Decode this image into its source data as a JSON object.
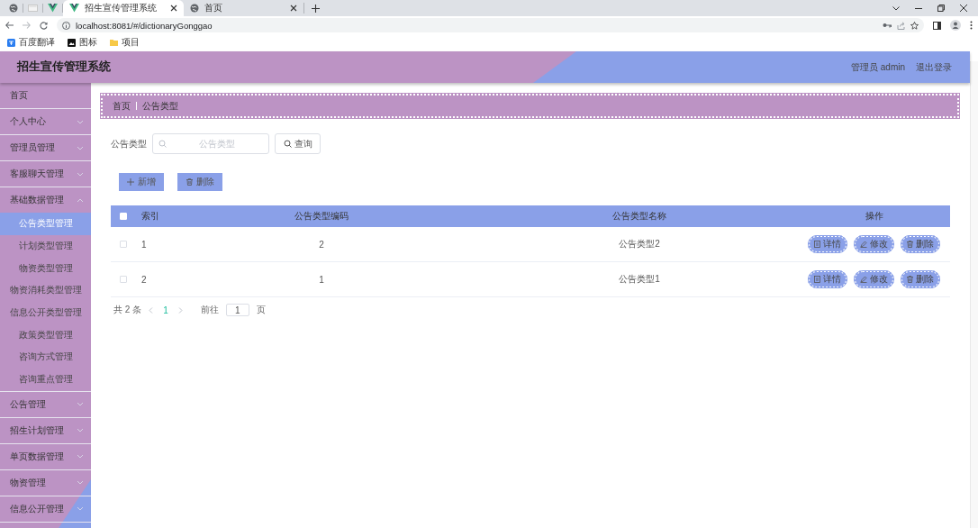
{
  "browser": {
    "tabs": [
      {
        "kind": "globe",
        "selected": false
      },
      {
        "kind": "blank",
        "selected": false
      },
      {
        "kind": "vue",
        "selected": false
      },
      {
        "kind": "vue",
        "label": "招生宣传管理系统",
        "selected": true
      },
      {
        "kind": "globe",
        "label": "首页",
        "selected": false
      }
    ],
    "address": "localhost:8081/#/dictionaryGonggao",
    "bookmarks": [
      {
        "kind": "translate",
        "label": "百度翻译"
      },
      {
        "kind": "image",
        "label": "图标"
      },
      {
        "kind": "folder",
        "label": "项目"
      }
    ]
  },
  "app": {
    "title": "招生宣传管理系统",
    "user": "管理员 admin",
    "logout": "退出登录"
  },
  "sidebar": {
    "items": [
      {
        "label": "首页",
        "kind": "link"
      },
      {
        "label": "个人中心",
        "kind": "menu",
        "expanded": false
      },
      {
        "label": "管理员管理",
        "kind": "menu",
        "expanded": false
      },
      {
        "label": "客服聊天管理",
        "kind": "menu",
        "expanded": false
      },
      {
        "label": "基础数据管理",
        "kind": "menu",
        "expanded": true,
        "children": [
          {
            "label": "公告类型管理",
            "selected": true
          },
          {
            "label": "计划类型管理",
            "selected": false
          },
          {
            "label": "物资类型管理",
            "selected": false
          },
          {
            "label": "物资消耗类型管理",
            "selected": false
          },
          {
            "label": "信息公开类型管理",
            "selected": false
          },
          {
            "label": "政策类型管理",
            "selected": false
          },
          {
            "label": "咨询方式管理",
            "selected": false
          },
          {
            "label": "咨询重点管理",
            "selected": false
          }
        ]
      },
      {
        "label": "公告管理",
        "kind": "menu",
        "expanded": false
      },
      {
        "label": "招生计划管理",
        "kind": "menu",
        "expanded": false
      },
      {
        "label": "单页数据管理",
        "kind": "menu",
        "expanded": false
      },
      {
        "label": "物资管理",
        "kind": "menu",
        "expanded": false
      },
      {
        "label": "信息公开管理",
        "kind": "menu",
        "expanded": false
      }
    ]
  },
  "breadcrumb": [
    "首页",
    "公告类型"
  ],
  "search": {
    "label": "公告类型",
    "placeholder": "公告类型",
    "button": "查询"
  },
  "actions": [
    {
      "kind": "add",
      "label": "新增"
    },
    {
      "kind": "delete",
      "label": "删除"
    }
  ],
  "table": {
    "select_all": false,
    "columns": [
      {
        "label": "索引"
      },
      {
        "label": "公告类型编码"
      },
      {
        "label": "公告类型名称"
      },
      {
        "label": "操作"
      }
    ],
    "rows": [
      {
        "checked": false,
        "cells": [
          "1",
          "2",
          "公告类型2"
        ],
        "actions": [
          {
            "kind": "detail",
            "label": "详情"
          },
          {
            "kind": "edit",
            "label": "修改"
          },
          {
            "kind": "delete",
            "label": "删除"
          }
        ]
      },
      {
        "checked": false,
        "cells": [
          "2",
          "1",
          "公告类型1"
        ],
        "actions": [
          {
            "kind": "detail",
            "label": "详情"
          },
          {
            "kind": "edit",
            "label": "修改"
          },
          {
            "kind": "delete",
            "label": "删除"
          }
        ]
      }
    ]
  },
  "pagination": {
    "total": "共 2 条",
    "pages": [
      {
        "label": "1",
        "selected": true
      }
    ],
    "goto": "前往",
    "goto_value": "1",
    "suffix": "页"
  }
}
